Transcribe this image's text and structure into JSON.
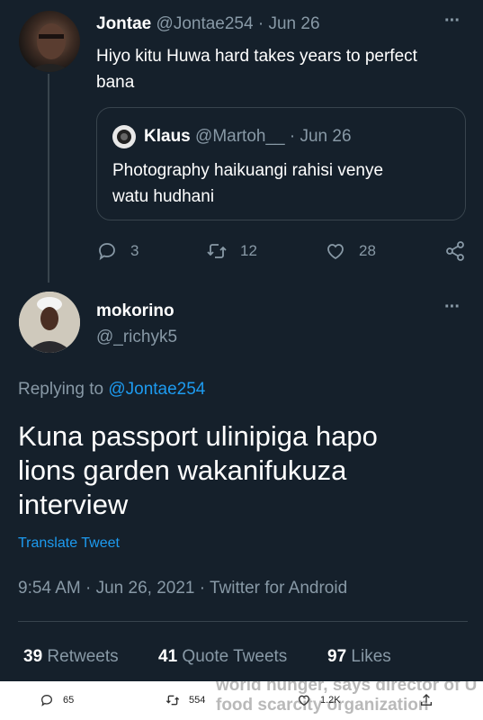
{
  "tweet1": {
    "name": "Jontae",
    "handle": "@Jontae254",
    "date": "· Jun 26",
    "text_line1": "Hiyo kitu Huwa hard takes years to perfect",
    "text_line2": "bana",
    "quote": {
      "name": "Klaus",
      "handle": "@Martoh__",
      "date": "· Jun 26",
      "text_line1": "Photography haikuangi rahisi venye",
      "text_line2": "watu hudhani"
    },
    "actions": {
      "replies": "3",
      "retweets": "12",
      "likes": "28"
    },
    "more": "···"
  },
  "tweet2": {
    "name": "mokorino",
    "handle": "@_richyk5",
    "more": "···",
    "replying_to_label": "Replying to",
    "replying_to_handle": "@Jontae254",
    "text_line1": "Kuna passport ulinipiga hapo",
    "text_line2": "lions garden wakanifukuza",
    "text_line3": "interview",
    "translate": "Translate Tweet",
    "timestamp": "9:54 AM · Jun 26, 2021 · Twitter for Android",
    "stats": {
      "retweets_count": "39",
      "retweets_label": "Retweets",
      "quotes_count": "41",
      "quotes_label": "Quote Tweets",
      "likes_count": "97",
      "likes_label": "Likes"
    }
  },
  "bottom_bar": {
    "replies": "65",
    "retweets": "554",
    "likes": "1.2K",
    "background_text_line1": "world hunger, says director of U",
    "background_text_line2": "food scarcity organization"
  },
  "colors": {
    "background": "#15202b",
    "accent": "#1d9bf0",
    "muted": "#8899a6",
    "border": "#38444d"
  }
}
